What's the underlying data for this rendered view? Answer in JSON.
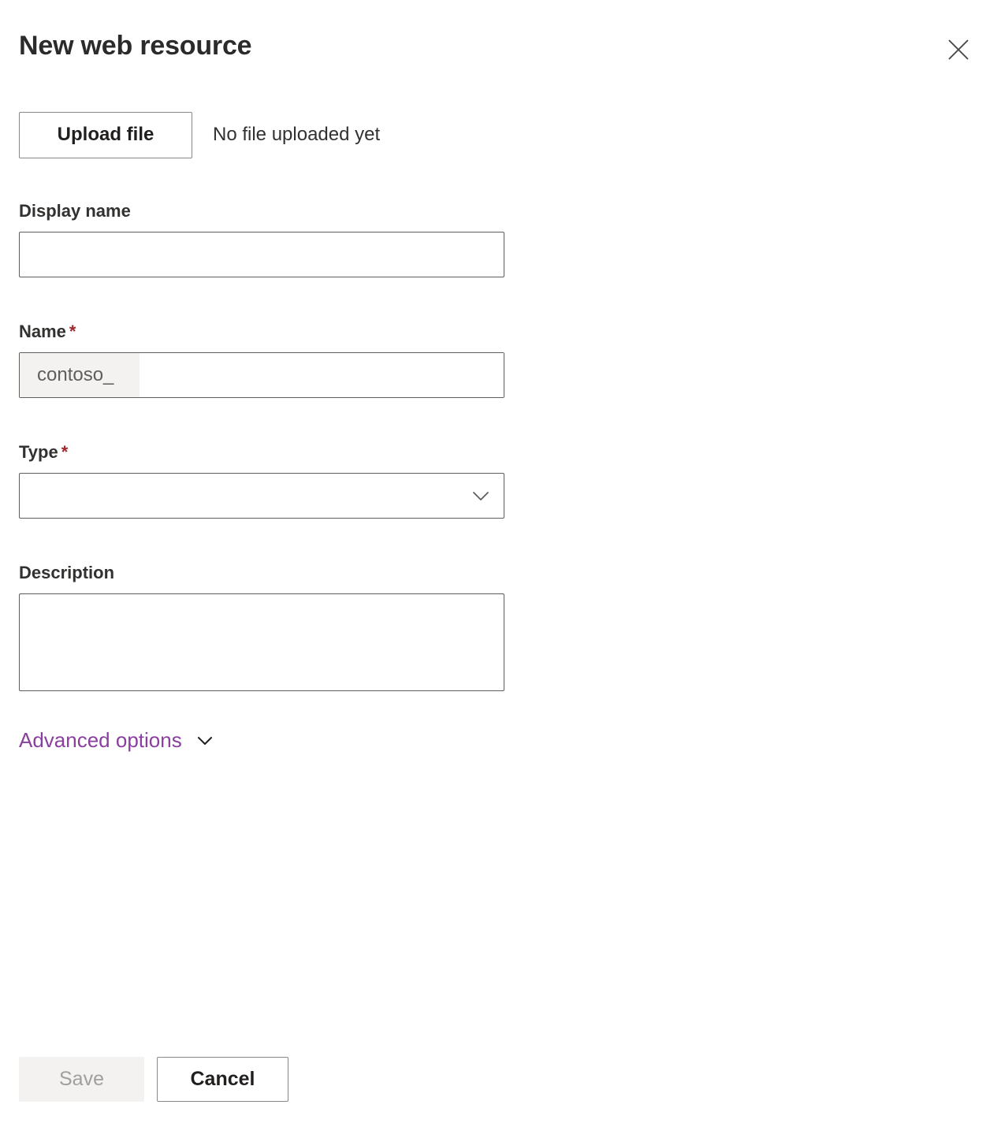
{
  "header": {
    "title": "New web resource",
    "close_icon": "close-icon"
  },
  "upload": {
    "button_label": "Upload file",
    "status_text": "No file uploaded yet"
  },
  "fields": {
    "display_name": {
      "label": "Display name",
      "value": "",
      "placeholder": ""
    },
    "name": {
      "label": "Name",
      "required_marker": "*",
      "prefix": "contoso_",
      "value": "",
      "placeholder": ""
    },
    "type": {
      "label": "Type",
      "required_marker": "*",
      "value": "",
      "caret_icon": "chevron-down-icon"
    },
    "description": {
      "label": "Description",
      "value": "",
      "placeholder": ""
    }
  },
  "advanced": {
    "label": "Advanced options",
    "caret_icon": "chevron-down-icon"
  },
  "footer": {
    "save_label": "Save",
    "cancel_label": "Cancel"
  },
  "colors": {
    "accent_link": "#8a3fa0",
    "required_asterisk": "#a4262c",
    "text_primary": "#323130",
    "border_input": "#605e5c",
    "border_button": "#8a8886",
    "disabled_bg": "#f3f2f1",
    "disabled_text": "#a19f9d",
    "prefix_bg": "#f3f2f1"
  }
}
